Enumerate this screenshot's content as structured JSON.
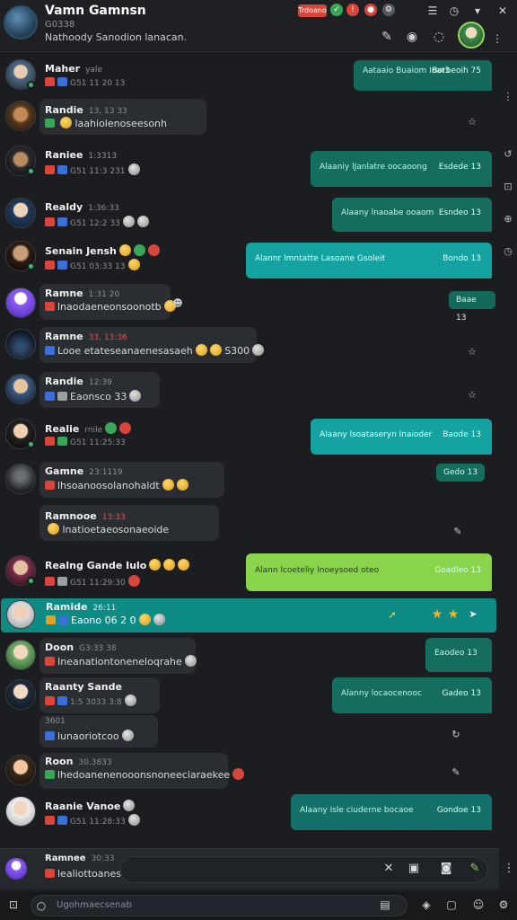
{
  "header": {
    "title": "Vamn Gamnsn",
    "subtitle": "G0338",
    "status": "Nathoody Sanodion lanacan.",
    "badge": "Trdoano",
    "icons": [
      "alert-icon",
      "gear-icon",
      "history-icon",
      "close-icon"
    ],
    "actions": [
      "tools-icon",
      "account-icon",
      "chat-icon"
    ]
  },
  "messages": [
    {
      "name": "Maher",
      "meta": "yale",
      "time": "G51 11 20 13",
      "text": ""
    },
    {
      "name": "Randie",
      "meta": "13, 13 33",
      "time": "",
      "text": "laahiolenoseesonh"
    },
    {
      "name": "Raniee",
      "meta": "1:3313",
      "time": "G51 11:3 231",
      "text": ""
    },
    {
      "name": "Realdy",
      "meta": "1:36:33",
      "time": "G51 12:2 33",
      "text": ""
    },
    {
      "name": "Senain Jensh",
      "meta": "",
      "time": "G51 03:33 13",
      "text": ""
    },
    {
      "name": "Ramne",
      "meta": "1:31 20",
      "time": "",
      "text": "lnaodaeneonsoonotb"
    },
    {
      "name": "Ramne",
      "meta": "33, 13:36",
      "time": "",
      "text": "Looe etateseanaenesasaeh",
      "extra": "S300"
    },
    {
      "name": "Randie",
      "meta": "12:39",
      "time": "",
      "text": "Eaonsco 33"
    },
    {
      "name": "Realie",
      "meta": "rnile",
      "time": "G51 11:25:33",
      "text": ""
    },
    {
      "name": "Gamne",
      "meta": "23:1119",
      "time": "",
      "text": "lhsoanoosolanohaldt"
    },
    {
      "name": "Ramnooe",
      "meta": "13:33",
      "time": "",
      "text": "lnatioetaeosonaeoide"
    },
    {
      "name": "Realng Gande Iulo",
      "meta": "",
      "time": "G51 11:29:30",
      "text": ""
    },
    {
      "name": "Ramide",
      "meta": "26:11",
      "time": "",
      "text": "Eaono 06 2 0"
    },
    {
      "name": "Doon",
      "meta": "G3:33 38",
      "time": "",
      "text": "Ineanationtoneneloqrahe"
    },
    {
      "name": "Raanty Sande",
      "meta": "",
      "time": "1:5 3033 3:8",
      "text": ""
    },
    {
      "name": "",
      "meta": "3601",
      "time": "",
      "text": "lunaoriotcoo"
    },
    {
      "name": "Roon",
      "meta": "30.3833",
      "time": "",
      "text": "lhedoanenenooonsnoneeciaraekee"
    },
    {
      "name": "Raanie Vanoe",
      "meta": "",
      "time": "G51 11:28:33",
      "text": ""
    },
    {
      "name": "Ramnee",
      "meta": "30:33",
      "time": "",
      "text": "lealiottoaneste"
    }
  ],
  "outgoing": [
    {
      "text": "Aataaio Buaiom Inat3",
      "time": "Borbeoih 75",
      "color": "#14695a"
    },
    {
      "text": "Alaaniy lJanlatre oocaoong",
      "time": "Esdede 13",
      "color": "#156d5e"
    },
    {
      "text": "Alaany lnaoabe ooaom",
      "time": "Esndeo 13",
      "color": "#156d5e"
    },
    {
      "text": "Alannr lmntatte Lasoane Gsoleit",
      "time": "Bondo 13",
      "color": "#14a3a0"
    },
    {
      "text": "Alaany lsoataseryn lnaioder",
      "time": "Baode 13",
      "color": "#14a3a0"
    },
    {
      "text": "Alann lcoeteliy lnoeysoed oteo",
      "time": "Goadleo 13",
      "color": "#8ad44b"
    },
    {
      "text": "Alanny locaocenooc",
      "time": "Gadeo 13",
      "color": "#156d5e"
    },
    {
      "text": "Alaany Isle ciuderne bocaoe",
      "time": "Gondoe 13",
      "color": "#15706a"
    }
  ],
  "small_tags": [
    "Baae 13",
    "Gedo 13",
    "Eaodeo 13"
  ],
  "composer": {
    "placeholder": "Ramnee",
    "icons": [
      "mute-icon",
      "image-icon",
      "camera-icon",
      "send-icon"
    ]
  },
  "bottom_bar": {
    "search_placeholder": "Ugohmaecsenab",
    "icons": [
      "lock-icon",
      "chat-icon",
      "attach-icon",
      "grid-icon",
      "emoji-icon",
      "settings-icon"
    ]
  },
  "colors": {
    "accent": "#14a3a0",
    "highlight": "#0f8b86",
    "green": "#8ad44b",
    "red": "#d8453a"
  }
}
